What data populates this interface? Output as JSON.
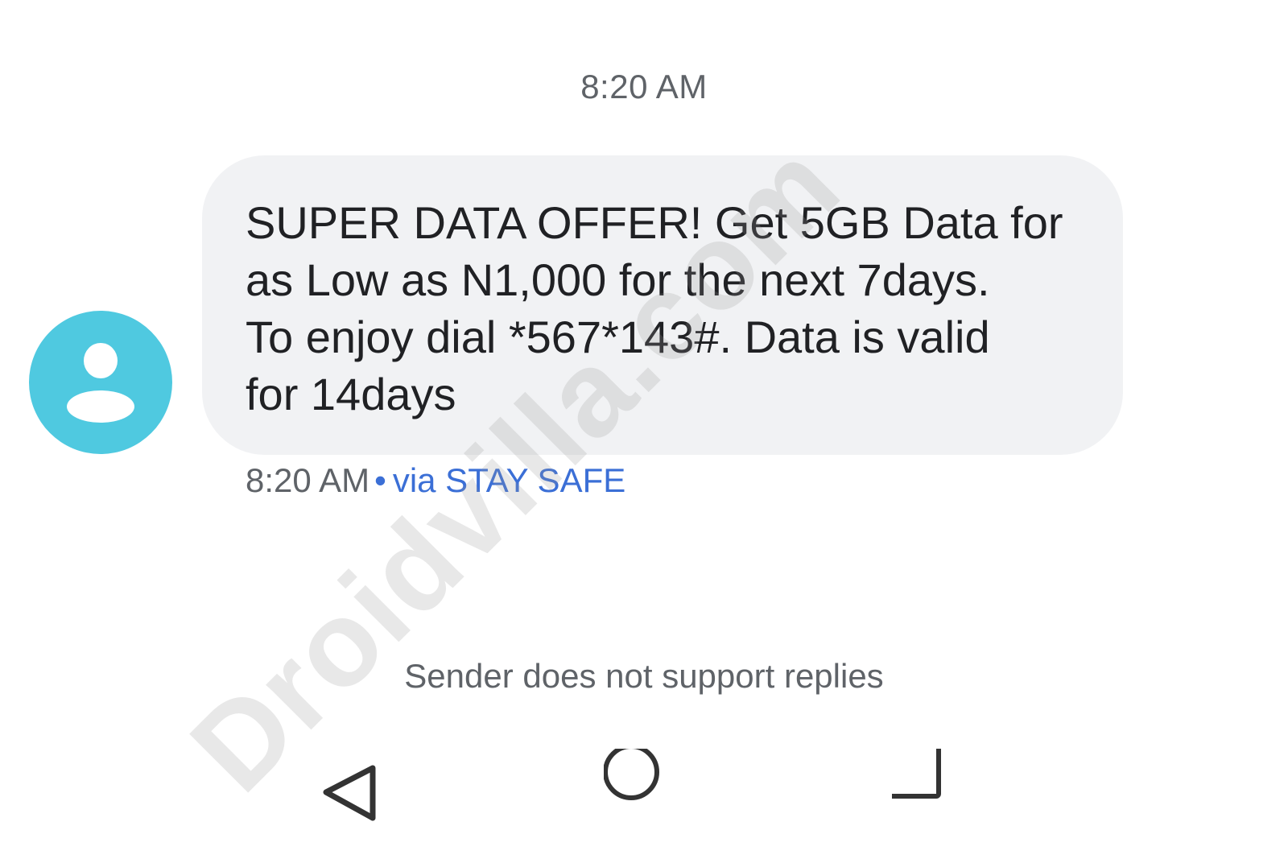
{
  "conversation": {
    "date_header": "8:20 AM",
    "message": {
      "text_lines": [
        "SUPER DATA OFFER! Get 5GB Data for",
        "as Low as N1,000 for the next 7days.",
        "To enjoy dial *567*143#. Data is valid",
        "for 14days"
      ],
      "time": "8:20 AM",
      "separator": "•",
      "via": "via STAY SAFE"
    },
    "reply_notice": "Sender does not support replies"
  },
  "avatar": {
    "icon": "person-icon",
    "color": "#4fc9e0"
  },
  "nav_bar": {
    "icons": [
      "back-triangle-icon",
      "home-circle-icon",
      "recents-square-icon"
    ]
  },
  "watermark": "Droidvilla.com",
  "colors": {
    "bubble": "#f1f2f4",
    "link": "#3b6fd6",
    "text": "#202124",
    "secondary_text": "#5f6368"
  }
}
